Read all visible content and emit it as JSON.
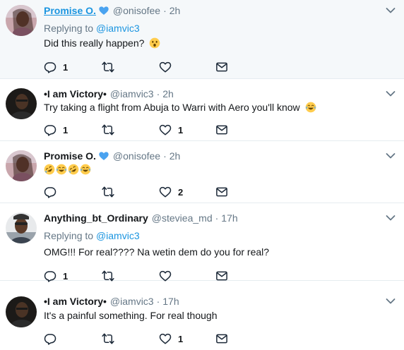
{
  "tweets": [
    {
      "name": "Promise O.",
      "handle": "@onisofee",
      "time": "2h",
      "replying_label": "Replying to",
      "replying_to": "@iamvic3",
      "text": "Did this really happen?",
      "emoji": "astonished-face",
      "reply_count": "1",
      "retweet_count": "",
      "like_count": ""
    },
    {
      "name": "•I am Victory•",
      "handle": "@iamvic3",
      "time": "2h",
      "text": "Try taking a flight from Abuja to Warri with Aero you'll know",
      "emoji": "tears-of-joy-face",
      "reply_count": "1",
      "retweet_count": "",
      "like_count": "1"
    },
    {
      "name": "Promise O.",
      "handle": "@onisofee",
      "time": "2h",
      "text": "",
      "emojis": [
        "rolling-on-floor-laughing",
        "tears-of-joy-face",
        "rolling-on-floor-laughing",
        "tears-of-joy-face"
      ],
      "reply_count": "",
      "retweet_count": "",
      "like_count": "2"
    },
    {
      "name": "Anything_bt_Ordinary",
      "handle": "@steviea_md",
      "time": "17h",
      "replying_label": "Replying to",
      "replying_to": "@iamvic3",
      "text": "OMG!!! For real???? Na wetin dem do you for real?",
      "reply_count": "1",
      "retweet_count": "",
      "like_count": ""
    },
    {
      "name": "•I am Victory•",
      "handle": "@iamvic3",
      "time": "17h",
      "text": "It's a painful something. For real though",
      "reply_count": "",
      "retweet_count": "",
      "like_count": "1"
    }
  ],
  "separator": "·",
  "colors": {
    "accent": "#1b95e0",
    "muted": "#657786",
    "text": "#14171a",
    "highlight_bg": "#f5f8fa",
    "thread_line": "#ccd6dd"
  }
}
